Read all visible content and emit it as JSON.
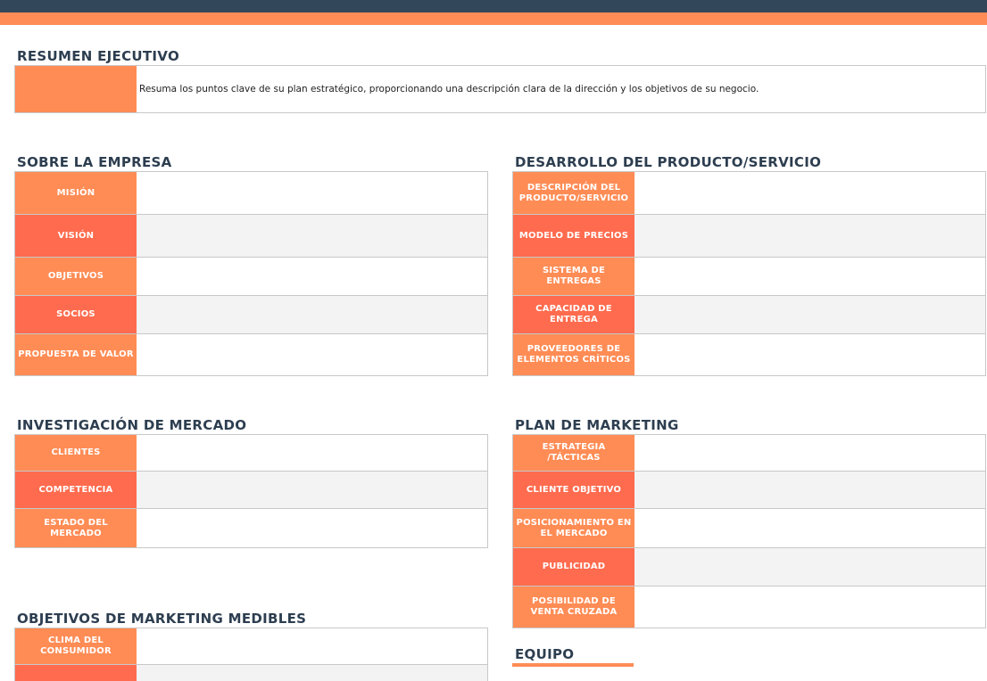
{
  "colors": {
    "header_dark": "#33475b",
    "accent_orange": "#ff8c55",
    "accent_coral": "#ff6b4e",
    "title": "#2d3e50"
  },
  "resumen": {
    "title": "RESUMEN EJECUTIVO",
    "text": "Resuma los puntos clave de su plan estratégico, proporcionando una descripción clara de la dirección y los objetivos de su negocio."
  },
  "empresa": {
    "title": "SOBRE LA EMPRESA",
    "rows": [
      "MISIÓN",
      "VISIÓN",
      "OBJETIVOS",
      "SOCIOS",
      "PROPUESTA DE VALOR"
    ]
  },
  "producto": {
    "title": "DESARROLLO DEL PRODUCTO/SERVICIO",
    "rows": [
      "DESCRIPCIÓN DEL PRODUCTO/SERVICIO",
      "MODELO DE PRECIOS",
      "SISTEMA DE ENTREGAS",
      "CAPACIDAD DE ENTREGA",
      "PROVEEDORES DE ELEMENTOS CRÍTICOS"
    ]
  },
  "mercado": {
    "title": "INVESTIGACIÓN DE MERCADO",
    "rows": [
      "CLIENTES",
      "COMPETENCIA",
      "ESTADO DEL MERCADO"
    ]
  },
  "marketing": {
    "title": "PLAN DE MARKETING",
    "rows": [
      "ESTRATEGIA /TÁCTICAS",
      "CLIENTE OBJETIVO",
      "POSICIONAMIENTO EN EL MERCADO",
      "PUBLICIDAD",
      "POSIBILIDAD DE VENTA CRUZADA"
    ]
  },
  "objetivos": {
    "title": "OBJETIVOS DE MARKETING MEDIBLES",
    "rows": [
      "CLIMA DEL CONSUMIDOR"
    ]
  },
  "equipo": {
    "title": "EQUIPO"
  }
}
